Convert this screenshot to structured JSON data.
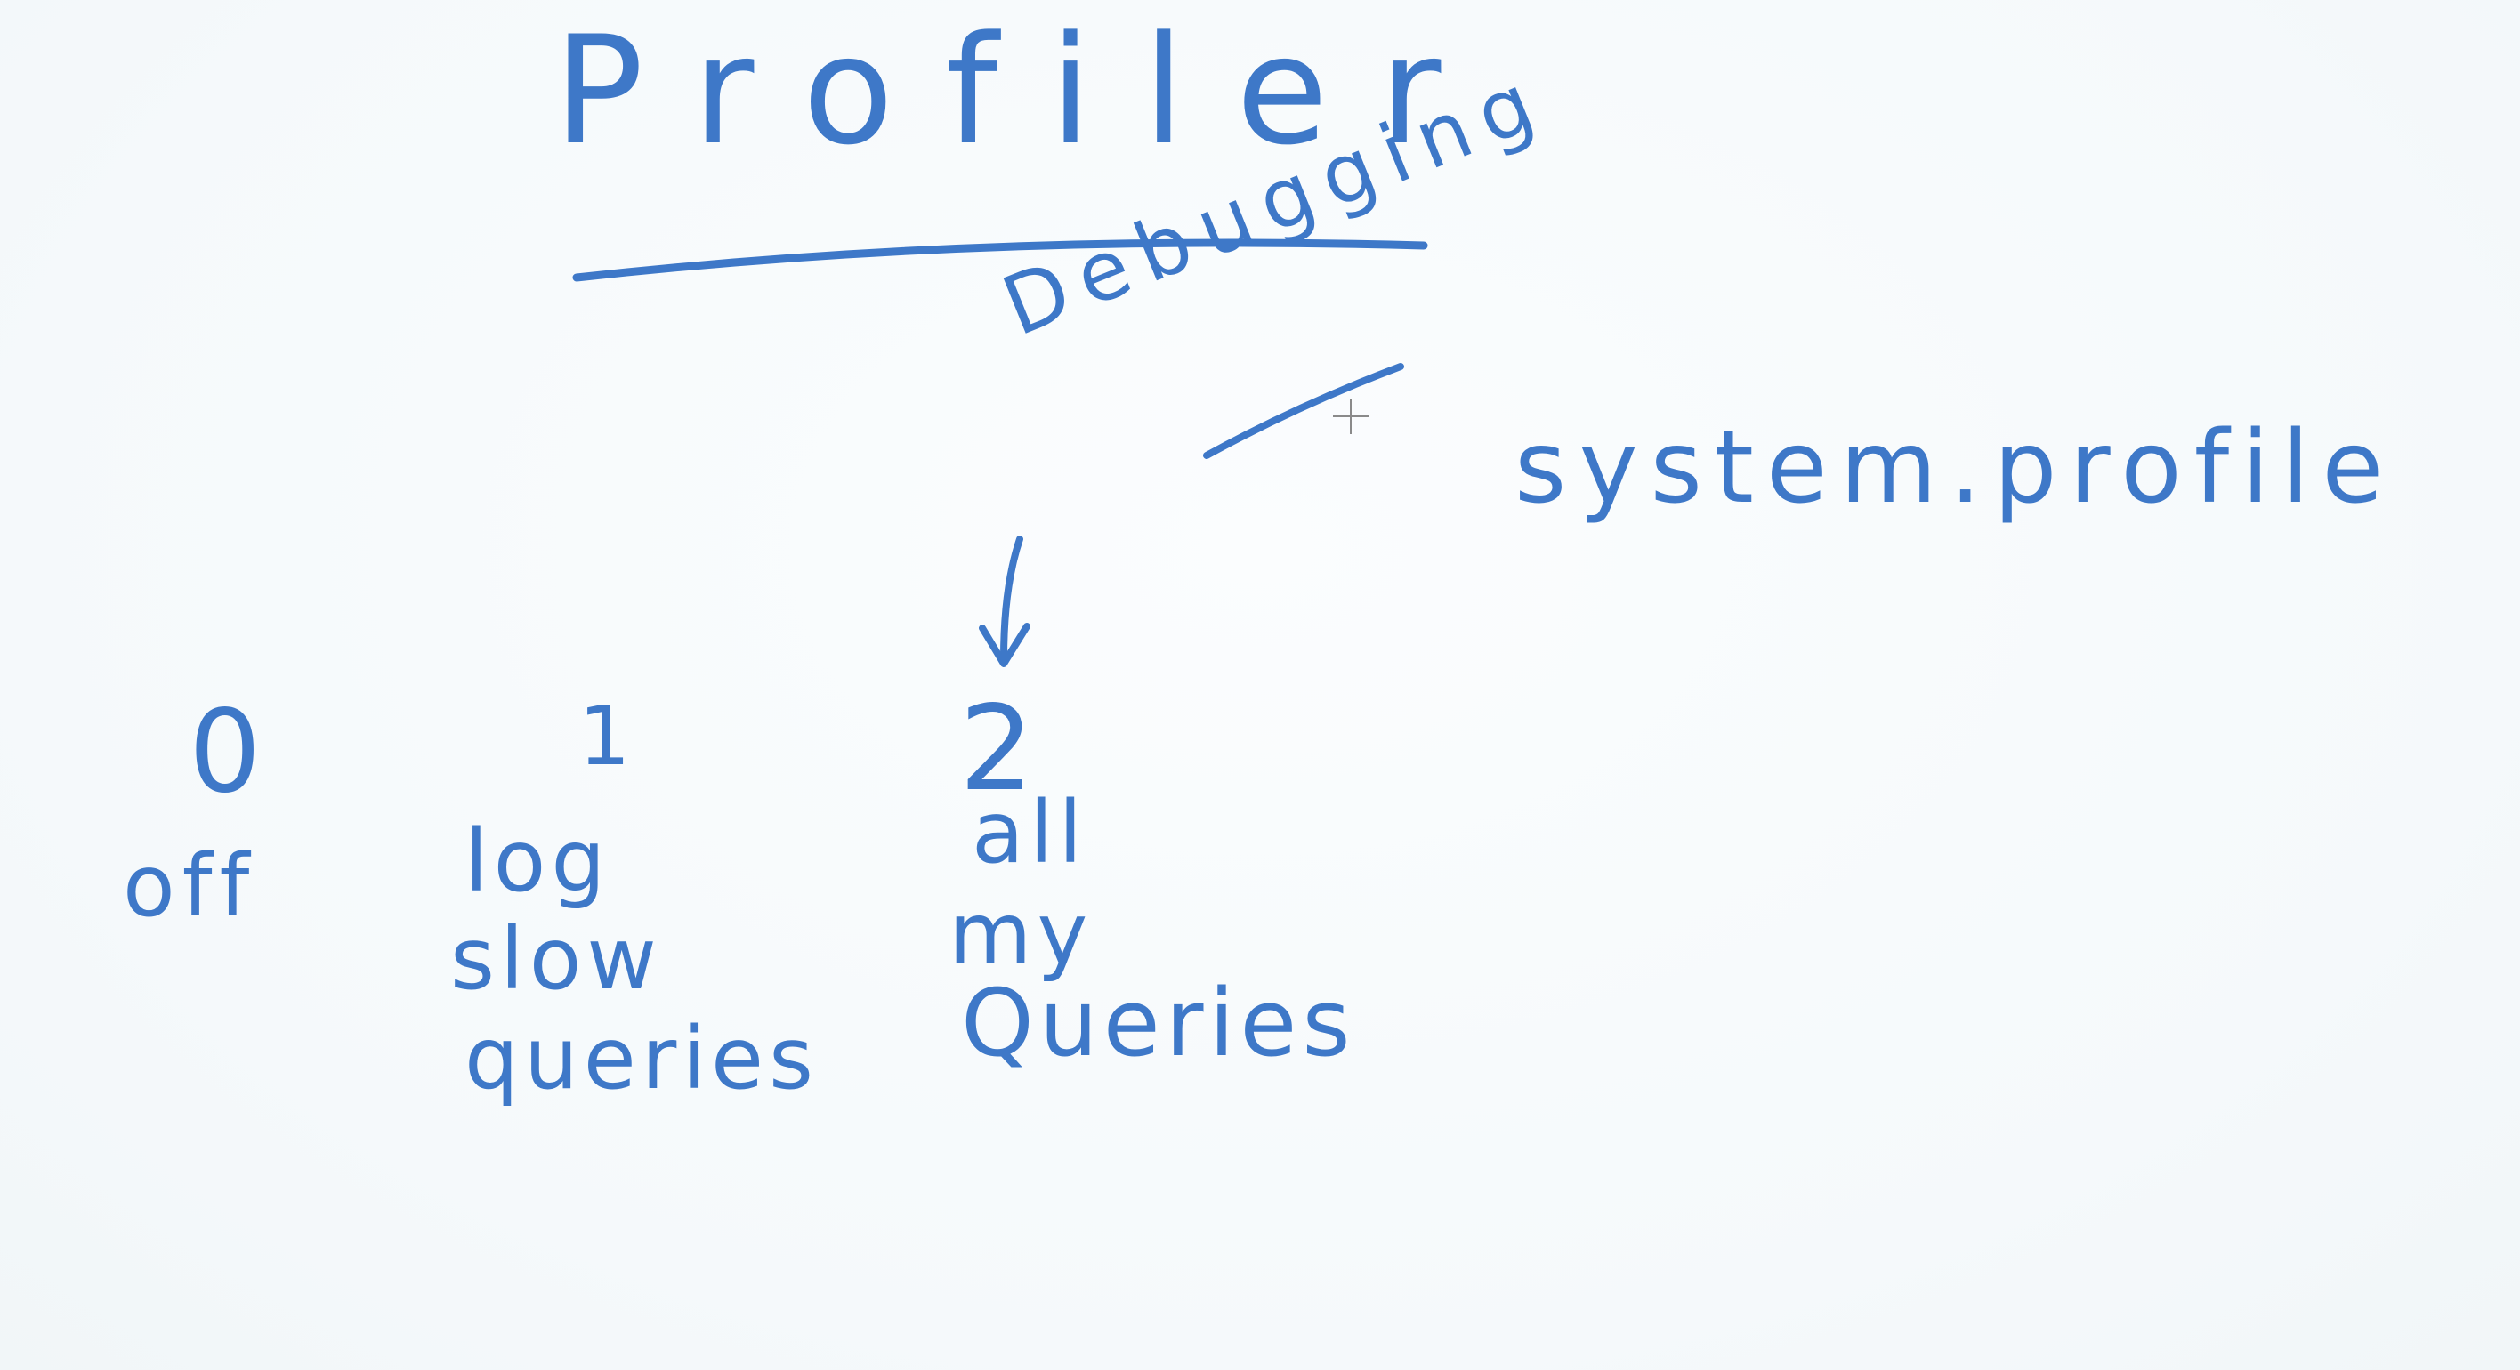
{
  "board": {
    "title": "Profiler",
    "annotation": "Debugging",
    "collection": "system.profile",
    "levels": [
      {
        "number": "0",
        "lines": [
          "off"
        ]
      },
      {
        "number": "1",
        "lines": [
          "log",
          "slow",
          "queries"
        ]
      },
      {
        "number": "2",
        "lines": [
          "all",
          "my",
          "Queries"
        ]
      }
    ]
  },
  "colors": {
    "ink": "#3e78c8",
    "background": "#f7fbfd"
  }
}
